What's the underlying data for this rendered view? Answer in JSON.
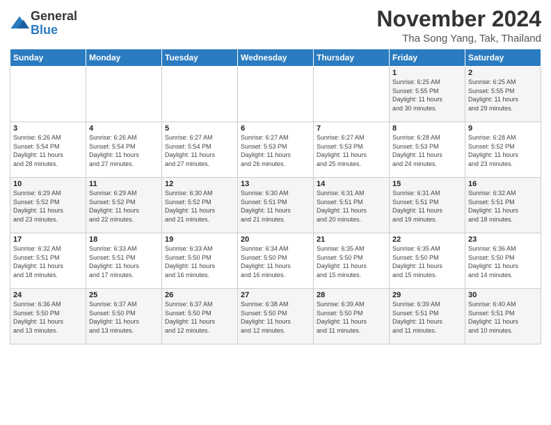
{
  "logo": {
    "general": "General",
    "blue": "Blue"
  },
  "title": {
    "month": "November 2024",
    "location": "Tha Song Yang, Tak, Thailand"
  },
  "calendar": {
    "headers": [
      "Sunday",
      "Monday",
      "Tuesday",
      "Wednesday",
      "Thursday",
      "Friday",
      "Saturday"
    ],
    "weeks": [
      [
        {
          "day": "",
          "info": ""
        },
        {
          "day": "",
          "info": ""
        },
        {
          "day": "",
          "info": ""
        },
        {
          "day": "",
          "info": ""
        },
        {
          "day": "",
          "info": ""
        },
        {
          "day": "1",
          "info": "Sunrise: 6:25 AM\nSunset: 5:55 PM\nDaylight: 11 hours\nand 30 minutes."
        },
        {
          "day": "2",
          "info": "Sunrise: 6:25 AM\nSunset: 5:55 PM\nDaylight: 11 hours\nand 29 minutes."
        }
      ],
      [
        {
          "day": "3",
          "info": "Sunrise: 6:26 AM\nSunset: 5:54 PM\nDaylight: 11 hours\nand 28 minutes."
        },
        {
          "day": "4",
          "info": "Sunrise: 6:26 AM\nSunset: 5:54 PM\nDaylight: 11 hours\nand 27 minutes."
        },
        {
          "day": "5",
          "info": "Sunrise: 6:27 AM\nSunset: 5:54 PM\nDaylight: 11 hours\nand 27 minutes."
        },
        {
          "day": "6",
          "info": "Sunrise: 6:27 AM\nSunset: 5:53 PM\nDaylight: 11 hours\nand 26 minutes."
        },
        {
          "day": "7",
          "info": "Sunrise: 6:27 AM\nSunset: 5:53 PM\nDaylight: 11 hours\nand 25 minutes."
        },
        {
          "day": "8",
          "info": "Sunrise: 6:28 AM\nSunset: 5:53 PM\nDaylight: 11 hours\nand 24 minutes."
        },
        {
          "day": "9",
          "info": "Sunrise: 6:28 AM\nSunset: 5:52 PM\nDaylight: 11 hours\nand 23 minutes."
        }
      ],
      [
        {
          "day": "10",
          "info": "Sunrise: 6:29 AM\nSunset: 5:52 PM\nDaylight: 11 hours\nand 23 minutes."
        },
        {
          "day": "11",
          "info": "Sunrise: 6:29 AM\nSunset: 5:52 PM\nDaylight: 11 hours\nand 22 minutes."
        },
        {
          "day": "12",
          "info": "Sunrise: 6:30 AM\nSunset: 5:52 PM\nDaylight: 11 hours\nand 21 minutes."
        },
        {
          "day": "13",
          "info": "Sunrise: 6:30 AM\nSunset: 5:51 PM\nDaylight: 11 hours\nand 21 minutes."
        },
        {
          "day": "14",
          "info": "Sunrise: 6:31 AM\nSunset: 5:51 PM\nDaylight: 11 hours\nand 20 minutes."
        },
        {
          "day": "15",
          "info": "Sunrise: 6:31 AM\nSunset: 5:51 PM\nDaylight: 11 hours\nand 19 minutes."
        },
        {
          "day": "16",
          "info": "Sunrise: 6:32 AM\nSunset: 5:51 PM\nDaylight: 11 hours\nand 18 minutes."
        }
      ],
      [
        {
          "day": "17",
          "info": "Sunrise: 6:32 AM\nSunset: 5:51 PM\nDaylight: 11 hours\nand 18 minutes."
        },
        {
          "day": "18",
          "info": "Sunrise: 6:33 AM\nSunset: 5:51 PM\nDaylight: 11 hours\nand 17 minutes."
        },
        {
          "day": "19",
          "info": "Sunrise: 6:33 AM\nSunset: 5:50 PM\nDaylight: 11 hours\nand 16 minutes."
        },
        {
          "day": "20",
          "info": "Sunrise: 6:34 AM\nSunset: 5:50 PM\nDaylight: 11 hours\nand 16 minutes."
        },
        {
          "day": "21",
          "info": "Sunrise: 6:35 AM\nSunset: 5:50 PM\nDaylight: 11 hours\nand 15 minutes."
        },
        {
          "day": "22",
          "info": "Sunrise: 6:35 AM\nSunset: 5:50 PM\nDaylight: 11 hours\nand 15 minutes."
        },
        {
          "day": "23",
          "info": "Sunrise: 6:36 AM\nSunset: 5:50 PM\nDaylight: 11 hours\nand 14 minutes."
        }
      ],
      [
        {
          "day": "24",
          "info": "Sunrise: 6:36 AM\nSunset: 5:50 PM\nDaylight: 11 hours\nand 13 minutes."
        },
        {
          "day": "25",
          "info": "Sunrise: 6:37 AM\nSunset: 5:50 PM\nDaylight: 11 hours\nand 13 minutes."
        },
        {
          "day": "26",
          "info": "Sunrise: 6:37 AM\nSunset: 5:50 PM\nDaylight: 11 hours\nand 12 minutes."
        },
        {
          "day": "27",
          "info": "Sunrise: 6:38 AM\nSunset: 5:50 PM\nDaylight: 11 hours\nand 12 minutes."
        },
        {
          "day": "28",
          "info": "Sunrise: 6:39 AM\nSunset: 5:50 PM\nDaylight: 11 hours\nand 11 minutes."
        },
        {
          "day": "29",
          "info": "Sunrise: 6:39 AM\nSunset: 5:51 PM\nDaylight: 11 hours\nand 11 minutes."
        },
        {
          "day": "30",
          "info": "Sunrise: 6:40 AM\nSunset: 5:51 PM\nDaylight: 11 hours\nand 10 minutes."
        }
      ]
    ]
  }
}
